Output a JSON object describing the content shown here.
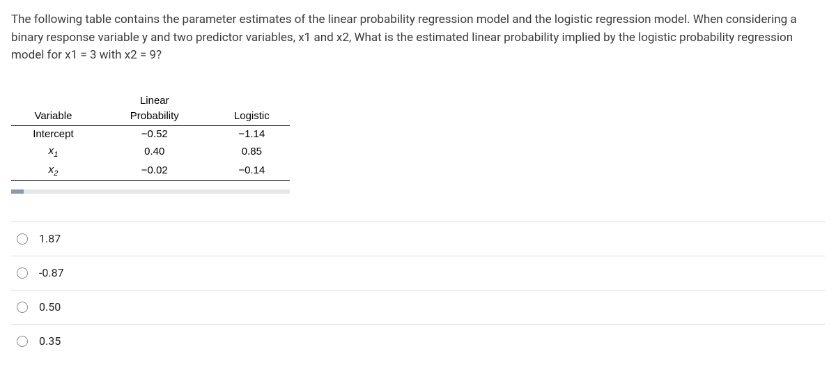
{
  "question": "The following table contains the parameter estimates of the linear probability regression model and the logistic regression model. When considering a binary response variable y and two predictor variables, x1 and x2, What is the estimated linear probability implied by the logistic probability regression model for x1 = 3 with x2 = 9?",
  "table": {
    "headers": {
      "variable": "Variable",
      "linear_prob": "Linear Probability",
      "logistic": "Logistic"
    },
    "rows": [
      {
        "variable": "Intercept",
        "linear": "−0.52",
        "logistic": "−1.14"
      },
      {
        "variable_html": "x1",
        "linear": "0.40",
        "logistic": "0.85"
      },
      {
        "variable_html": "x2",
        "linear": "−0.02",
        "logistic": "−0.14"
      }
    ]
  },
  "options": [
    {
      "label": "1.87"
    },
    {
      "label": "-0.87"
    },
    {
      "label": "0.50"
    },
    {
      "label": "0.35"
    }
  ]
}
